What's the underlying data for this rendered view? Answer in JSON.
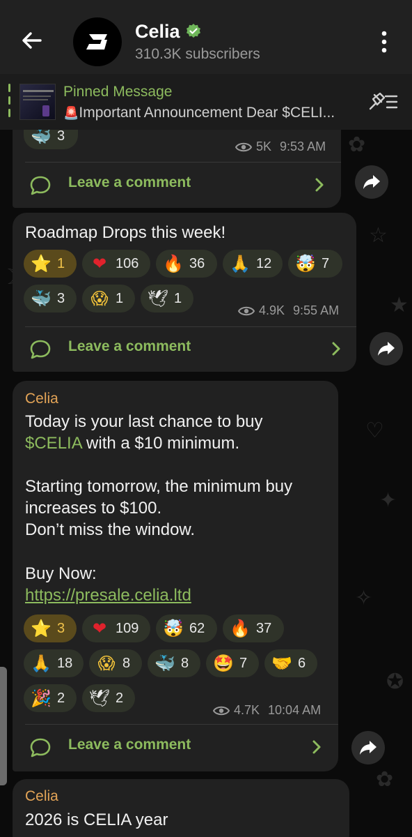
{
  "header": {
    "channel_name": "Celia",
    "subscribers": "310.3K subscribers"
  },
  "pinned": {
    "title": "Pinned Message",
    "text": "Important Announcement  Dear $CELI..."
  },
  "msg1": {
    "reaction": {
      "emoji": "🐳",
      "count": "3"
    },
    "views": "5K",
    "time": "9:53 AM",
    "comment_label": "Leave a comment"
  },
  "msg2": {
    "text": "Roadmap Drops this week!",
    "reactions": [
      {
        "emoji": "⭐",
        "count": "1"
      },
      {
        "emoji": "❤",
        "count": "106"
      },
      {
        "emoji": "🔥",
        "count": "36"
      },
      {
        "emoji": "🙏",
        "count": "12"
      },
      {
        "emoji": "🤯",
        "count": "7"
      },
      {
        "emoji": "🐳",
        "count": "3"
      },
      {
        "emoji": "😱",
        "count": "1"
      },
      {
        "emoji": "🕊",
        "count": "1"
      }
    ],
    "views": "4.9K",
    "time": "9:55 AM",
    "comment_label": "Leave a comment"
  },
  "msg3": {
    "sender": "Celia",
    "line1": "Today is your last chance to buy",
    "ticker": "$CELIA",
    "line2_rest": " with a $10 minimum.",
    "line3": "Starting tomorrow, the minimum buy",
    "line4": "increases to $100.",
    "line5": "Don’t miss the window.",
    "line6": "Buy Now:",
    "link": "https://presale.celia.ltd",
    "reactions": [
      {
        "emoji": "⭐",
        "count": "3"
      },
      {
        "emoji": "❤",
        "count": "109"
      },
      {
        "emoji": "🤯",
        "count": "62"
      },
      {
        "emoji": "🔥",
        "count": "37"
      },
      {
        "emoji": "🙏",
        "count": "18"
      },
      {
        "emoji": "😱",
        "count": "8"
      },
      {
        "emoji": "🐳",
        "count": "8"
      },
      {
        "emoji": "🤩",
        "count": "7"
      },
      {
        "emoji": "🤝",
        "count": "6"
      },
      {
        "emoji": "🎉",
        "count": "2"
      },
      {
        "emoji": "🕊",
        "count": "2"
      }
    ],
    "views": "4.7K",
    "time": "10:04 AM",
    "comment_label": "Leave a comment"
  },
  "msg4": {
    "sender": "Celia",
    "text": "2026 is CELIA year"
  },
  "colors": {
    "accent_green": "#8dbb5e",
    "sender_orange": "#e3a457",
    "bubble": "#212121",
    "star_chip": "#5a4a1c"
  }
}
